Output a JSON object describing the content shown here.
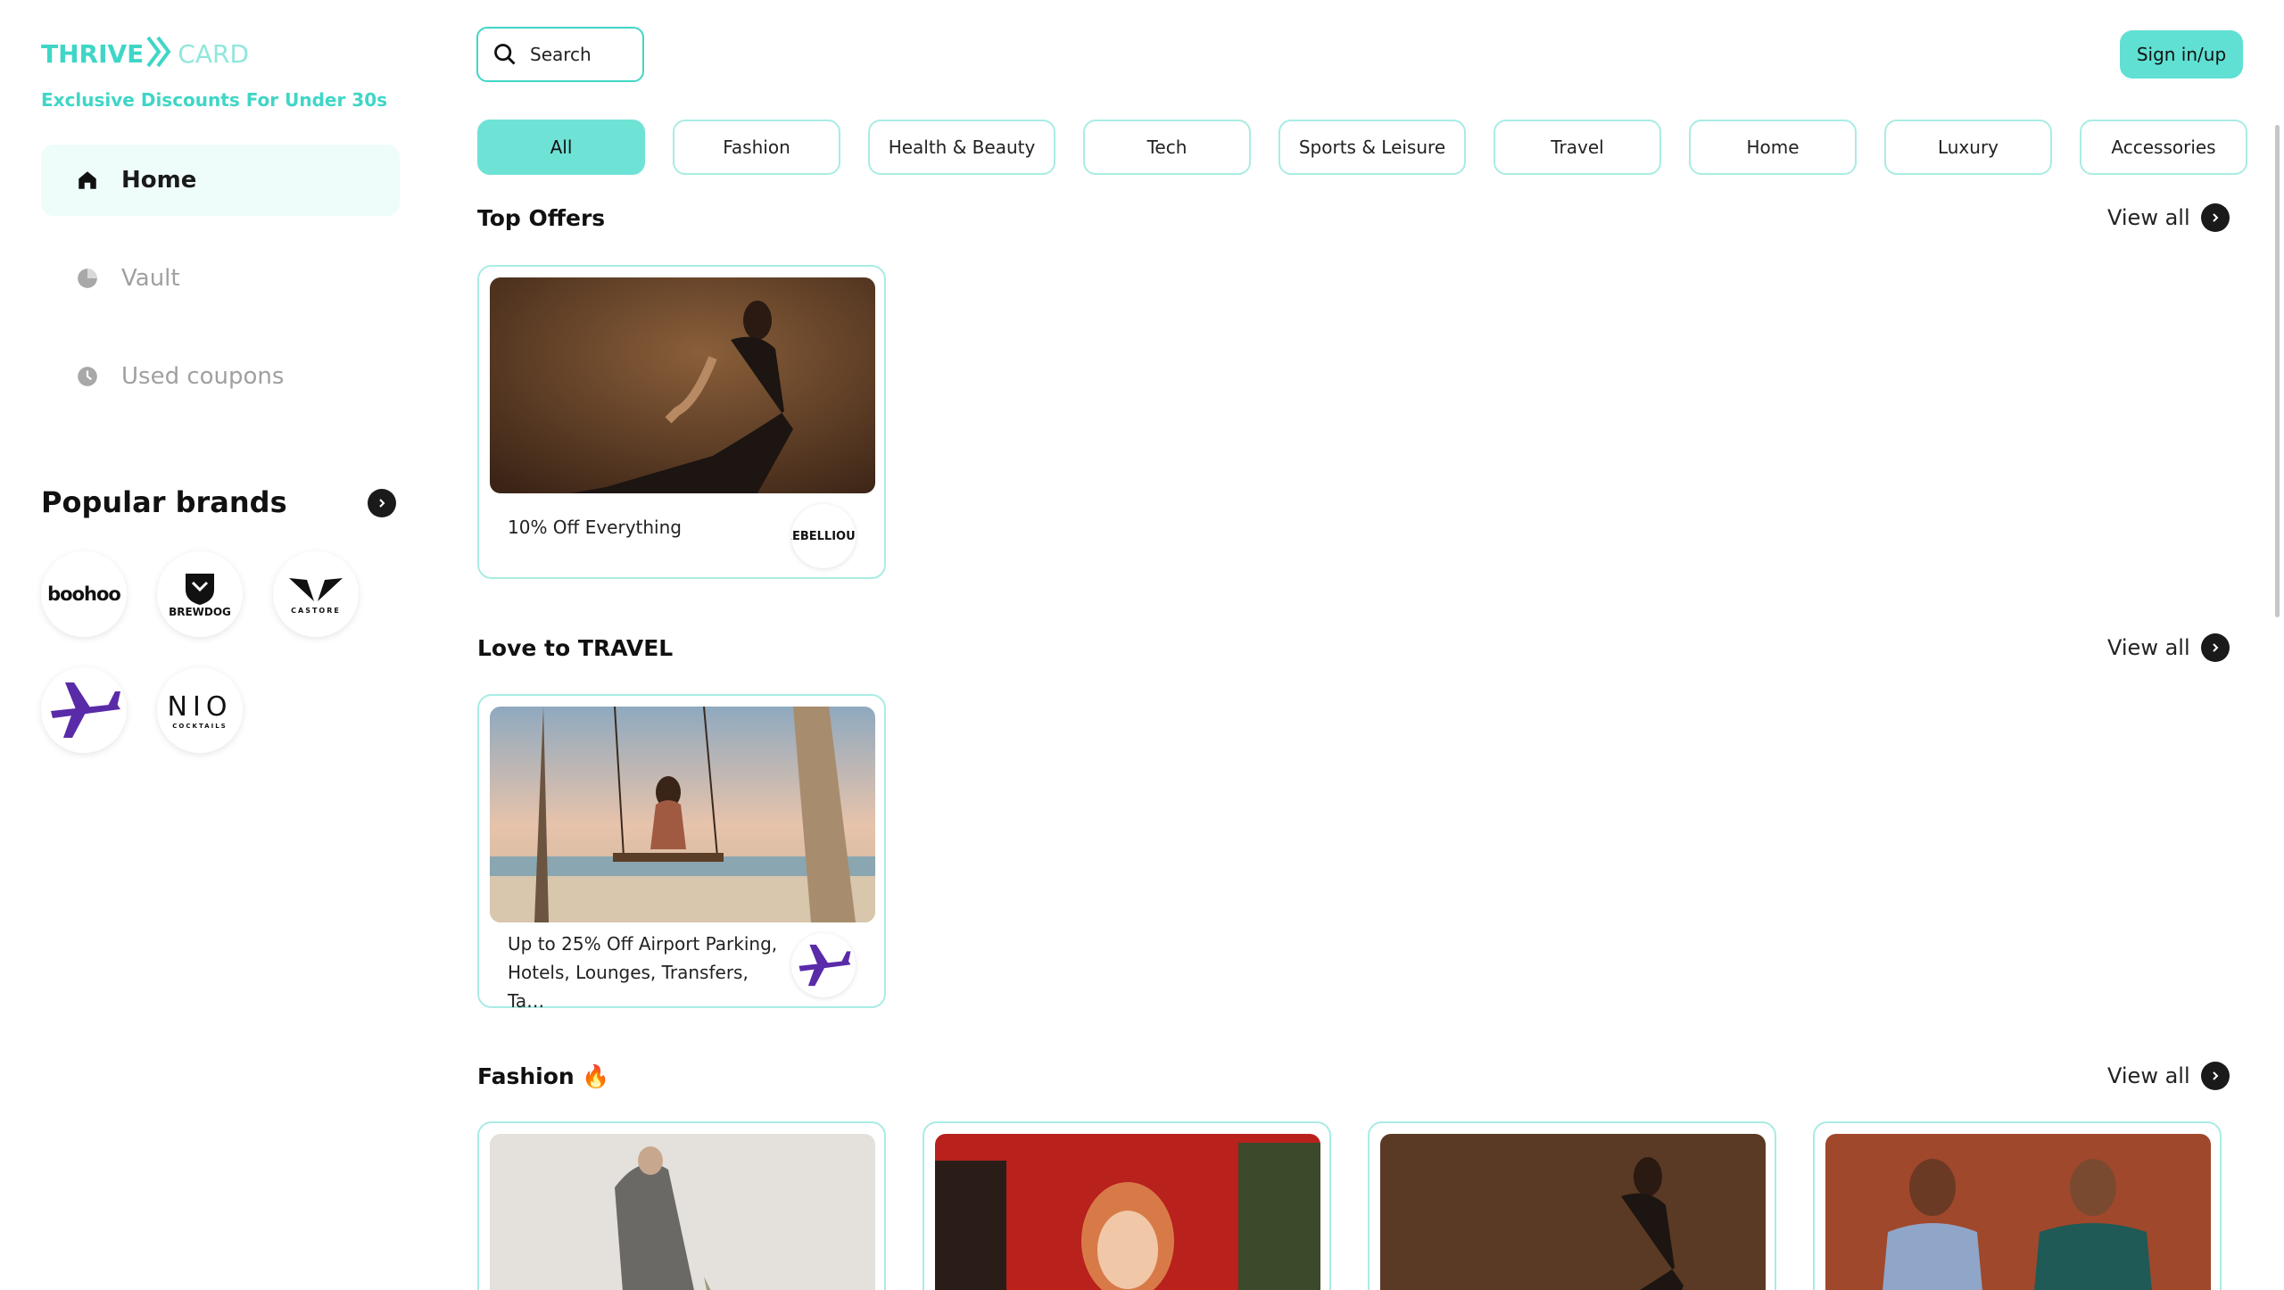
{
  "brand": {
    "logo_main": "THRIVE",
    "logo_suffix": "CARD",
    "tagline": "Exclusive Discounts For Under 30s"
  },
  "nav": [
    {
      "label": "Home",
      "icon": "home-icon",
      "active": true
    },
    {
      "label": "Vault",
      "icon": "pie-chart-icon",
      "active": false
    },
    {
      "label": "Used coupons",
      "icon": "clock-icon",
      "active": false
    }
  ],
  "popular_brands": {
    "title": "Popular brands",
    "items": [
      {
        "name": "boohoo",
        "text": "boohoo"
      },
      {
        "name": "brewdog",
        "text": "BREWDOG"
      },
      {
        "name": "castore",
        "text": "CASTORE"
      },
      {
        "name": "holiday-extras",
        "text": "holidayextras"
      },
      {
        "name": "nio-cocktails",
        "text": "NIO",
        "sub": "COCKTAILS"
      }
    ]
  },
  "header": {
    "search_label": "Search",
    "signin_label": "Sign in/up"
  },
  "categories": [
    "All",
    "Fashion",
    "Health & Beauty",
    "Tech",
    "Sports & Leisure",
    "Travel",
    "Home",
    "Luxury",
    "Accessories"
  ],
  "sections": {
    "top_offers": {
      "title": "Top Offers",
      "view_all": "View all",
      "offer": {
        "text": "10% Off Everything",
        "brand": "REBELLIOUS"
      }
    },
    "travel": {
      "title": "Love to TRAVEL",
      "view_all": "View all",
      "offer": {
        "text": "Up to 25% Off Airport Parking, Hotels, Lounges, Transfers, Ta…",
        "brand": "holidayextras"
      }
    },
    "fashion": {
      "title": "Fashion 🔥",
      "view_all": "View all"
    }
  },
  "colors": {
    "accent": "#3fd6c6",
    "chip_active": "#6fe2d6",
    "chip_border": "#a9ece4",
    "nav_active_bg": "#eefcfa"
  }
}
